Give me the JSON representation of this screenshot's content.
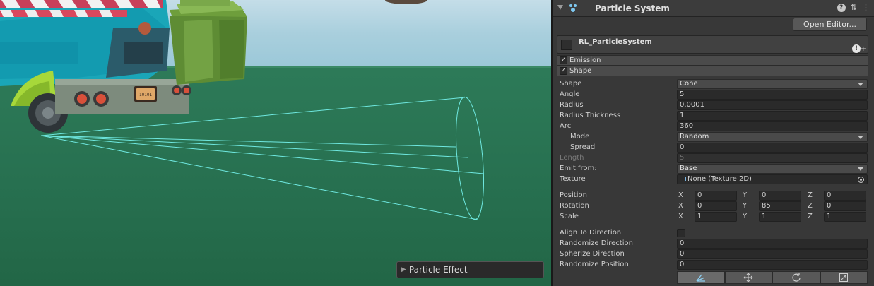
{
  "scene": {
    "overlay_title": "Particle Effect",
    "plate_text": "10101"
  },
  "inspector": {
    "component_title": "Particle System",
    "open_editor_label": "Open Editor...",
    "system_name": "RL_ParticleSystem",
    "modules": [
      {
        "label": "Emission",
        "enabled": true
      },
      {
        "label": "Shape",
        "enabled": true
      }
    ],
    "shape": {
      "shape_label": "Shape",
      "shape_value": "Cone",
      "angle_label": "Angle",
      "angle_value": "5",
      "radius_label": "Radius",
      "radius_value": "0.0001",
      "radius_thickness_label": "Radius Thickness",
      "radius_thickness_value": "1",
      "arc_label": "Arc",
      "arc_value": "360",
      "mode_label": "Mode",
      "mode_value": "Random",
      "spread_label": "Spread",
      "spread_value": "0",
      "length_label": "Length",
      "length_value": "5",
      "emit_from_label": "Emit from:",
      "emit_from_value": "Base",
      "texture_label": "Texture",
      "texture_value": "None (Texture 2D)",
      "position_label": "Position",
      "position": {
        "x": "0",
        "y": "0",
        "z": "0"
      },
      "rotation_label": "Rotation",
      "rotation": {
        "x": "0",
        "y": "85",
        "z": "0"
      },
      "scale_label": "Scale",
      "scale": {
        "x": "1",
        "y": "1",
        "z": "1"
      },
      "axis_x": "X",
      "axis_y": "Y",
      "axis_z": "Z",
      "align_label": "Align To Direction",
      "align_value": false,
      "randomize_direction_label": "Randomize Direction",
      "randomize_direction_value": "0",
      "spherize_direction_label": "Spherize Direction",
      "spherize_direction_value": "0",
      "randomize_position_label": "Randomize Position",
      "randomize_position_value": "0"
    },
    "checkmark": "✓",
    "warn_glyph": "!",
    "plus_glyph": "+",
    "help_glyph": "?",
    "icons": [
      "collapse-triangle-icon",
      "particle-system-icon",
      "help-icon",
      "preset-icon",
      "more-menu-icon",
      "warning-icon",
      "add-icon",
      "texture-icon",
      "object-picker-icon",
      "edit-shape-tool-icon",
      "move-tool-icon",
      "rotate-tool-icon",
      "scale-tool-icon"
    ],
    "colors": {
      "panel_bg": "#383838",
      "field_bg": "#2a2a2a",
      "cone_gizmo": "#6fe8e0",
      "ground": "#2d7a58"
    }
  }
}
